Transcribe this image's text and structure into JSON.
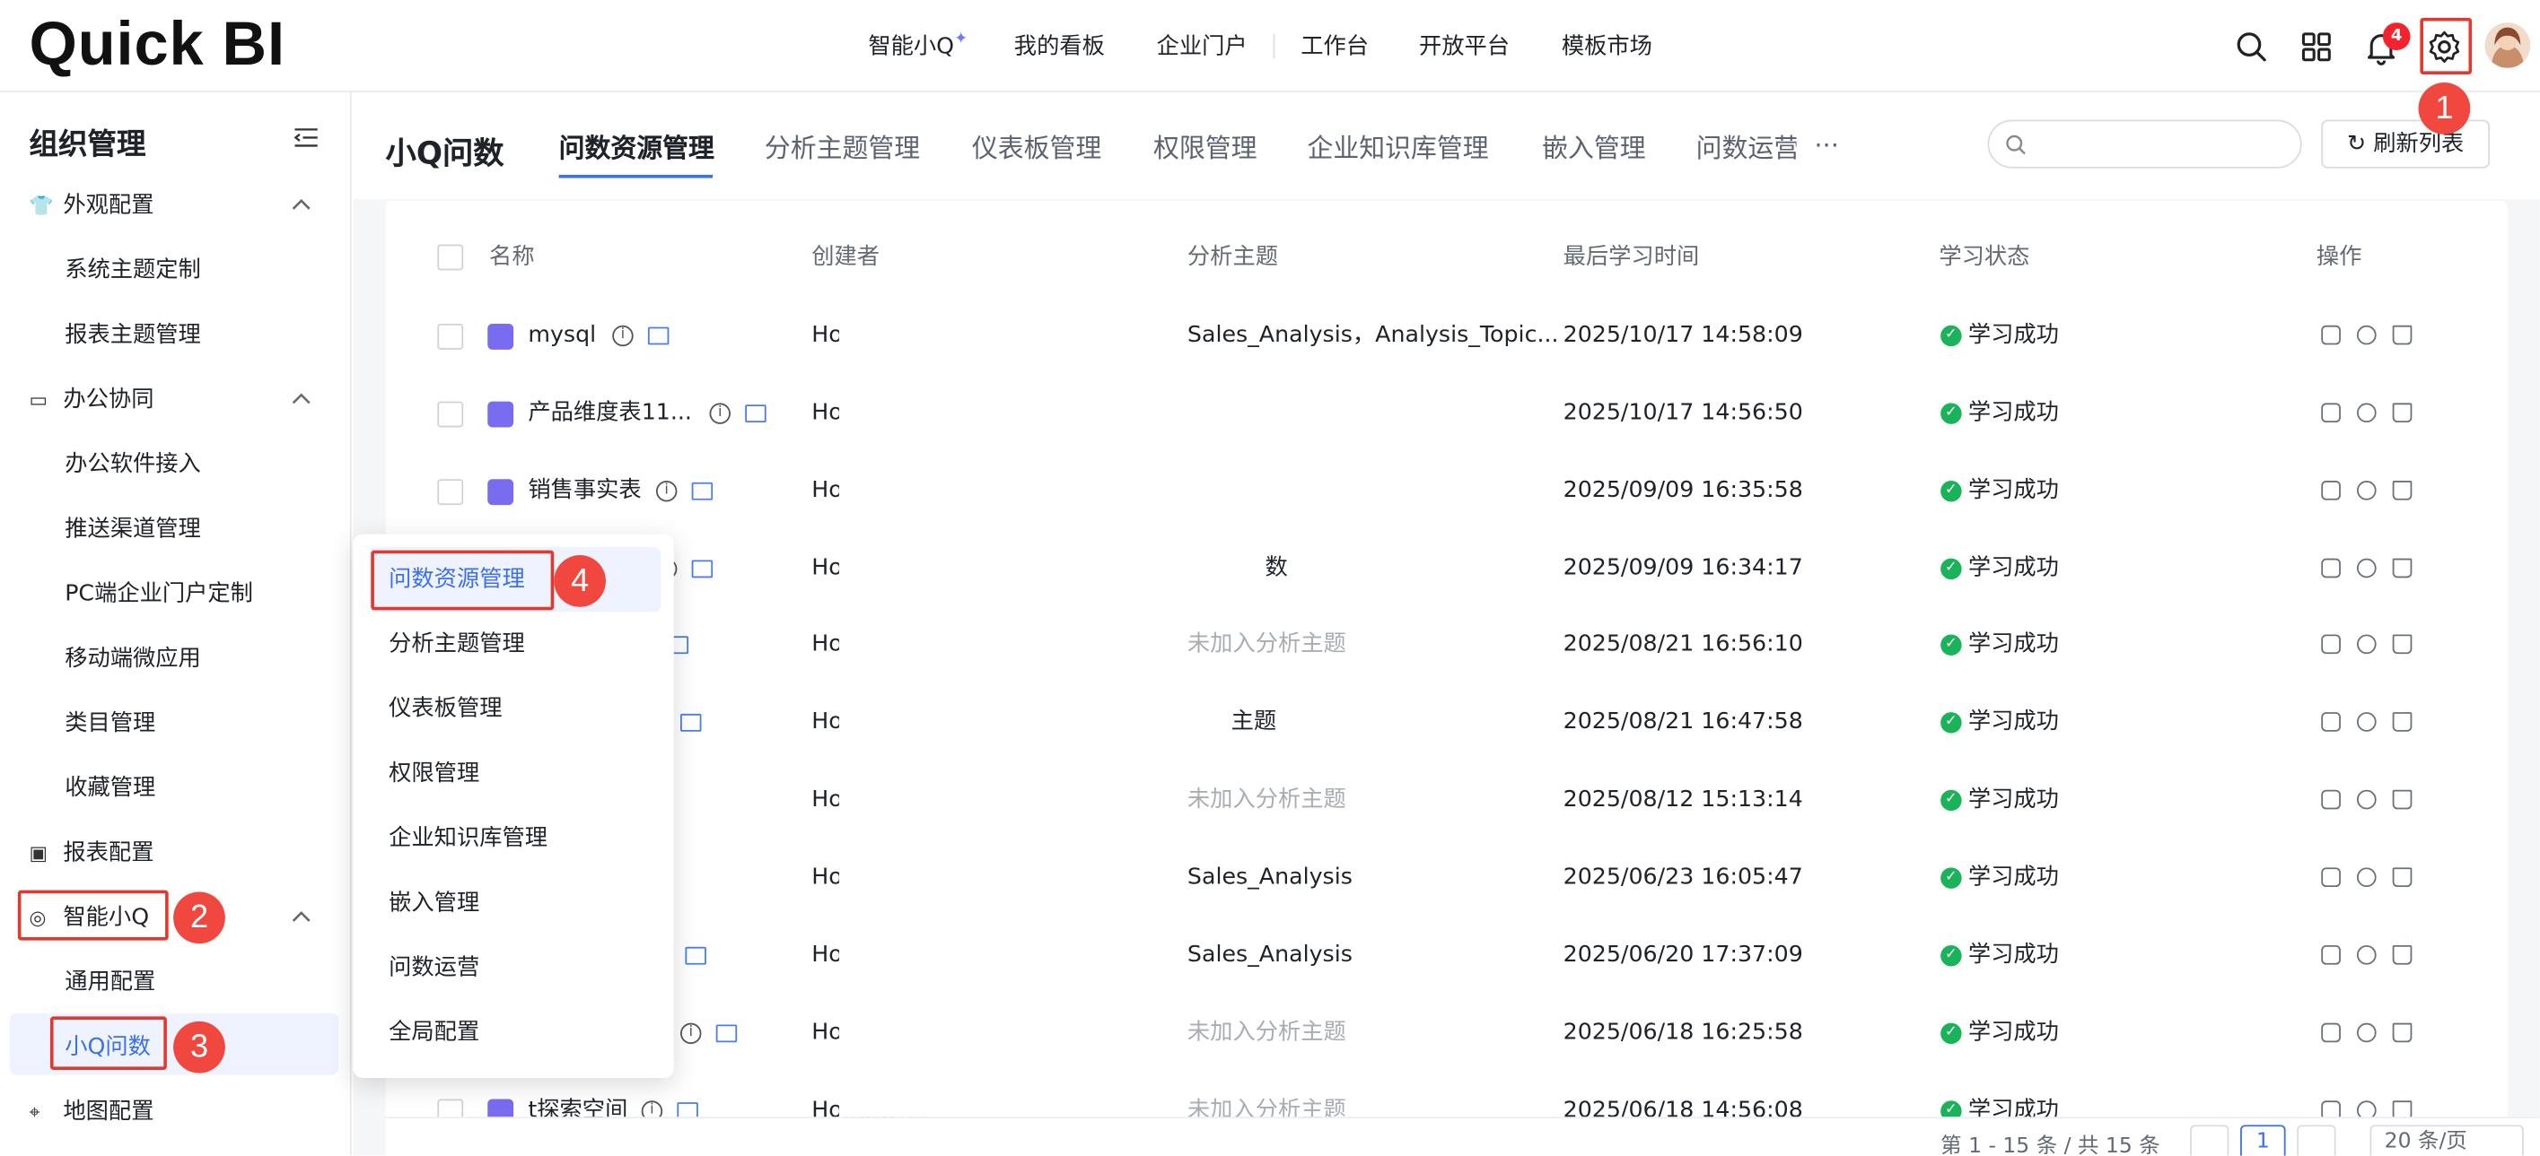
{
  "topbar": {
    "logo": "Quick BI",
    "nav": [
      "智能小Q",
      "我的看板",
      "企业门户",
      "工作台",
      "开放平台",
      "模板市场"
    ],
    "notification_count": "4",
    "icons": [
      "search-icon",
      "apps-grid-icon",
      "bell-icon",
      "gear-icon",
      "avatar"
    ]
  },
  "sidebar": {
    "title": "组织管理",
    "sections": [
      {
        "label": "外观配置",
        "icon": "shirt-icon",
        "items": [
          "系统主题定制",
          "报表主题管理"
        ]
      },
      {
        "label": "办公协同",
        "icon": "office-icon",
        "items": [
          "办公软件接入",
          "推送渠道管理",
          "PC端企业门户定制",
          "移动端微应用",
          "类目管理",
          "收藏管理"
        ]
      },
      {
        "label": "报表配置",
        "icon": "report-icon",
        "items": []
      },
      {
        "label": "智能小Q",
        "icon": "smart-q-icon",
        "items": [
          "通用配置",
          "小Q问数"
        ]
      },
      {
        "label": "地图配置",
        "icon": "map-icon",
        "items": []
      }
    ]
  },
  "content": {
    "title": "小Q问数",
    "tabs": [
      "问数资源管理",
      "分析主题管理",
      "仪表板管理",
      "权限管理",
      "企业知识库管理",
      "嵌入管理",
      "问数运营",
      "···"
    ],
    "search_placeholder": "",
    "refresh_label": "刷新列表",
    "columns": [
      "名称",
      "创建者",
      "分析主题",
      "最后学习时间",
      "学习状态",
      "操作"
    ],
    "rows": [
      {
        "name": "mysql",
        "creator": "Ho",
        "topic": "Sales_Analysis，Analysis_Topic...",
        "time": "2025/10/17 14:58:09",
        "status": "学习成功"
      },
      {
        "name": "产品维度表11...",
        "creator": "Ho",
        "topic": "",
        "time": "2025/10/17 14:56:50",
        "status": "学习成功"
      },
      {
        "name": "销售事实表",
        "creator": "Ho",
        "topic": "",
        "time": "2025/09/09 16:35:58",
        "status": "学习成功"
      },
      {
        "name": "",
        "creator": "Ho",
        "topic": "数",
        "time": "2025/09/09 16:34:17",
        "status": "学习成功"
      },
      {
        "name": "",
        "creator": "Ho",
        "topic": "未加入分析主题",
        "time": "2025/08/21 16:56:10",
        "status": "学习成功"
      },
      {
        "name": "",
        "creator": "Ho",
        "topic": "主题",
        "time": "2025/08/21 16:47:58",
        "status": "学习成功"
      },
      {
        "name": "",
        "creator": "Ho",
        "topic": "未加入分析主题",
        "time": "2025/08/12 15:13:14",
        "status": "学习成功"
      },
      {
        "name": "",
        "creator": "Ho",
        "topic": "Sales_Analysis",
        "time": "2025/06/23 16:05:47",
        "status": "学习成功"
      },
      {
        "name": "",
        "creator": "Ho",
        "topic": "Sales_Analysis",
        "time": "2025/06/20 17:37:09",
        "status": "学习成功"
      },
      {
        "name": "",
        "creator": "Ho",
        "topic": "未加入分析主题",
        "time": "2025/06/18 16:25:58",
        "status": "学习成功"
      },
      {
        "name": "t探索空间",
        "creator": "HongKong",
        "topic": "未加入分析主题",
        "time": "2025/06/18 14:56:08",
        "status": "学习成功"
      }
    ],
    "pager": {
      "summary": "第 1 - 15 条 / 共 15 条",
      "page": "1",
      "page_size": "20 条/页"
    }
  },
  "popup": {
    "items": [
      "问数资源管理",
      "分析主题管理",
      "仪表板管理",
      "权限管理",
      "企业知识库管理",
      "嵌入管理",
      "问数运营",
      "全局配置"
    ]
  },
  "callouts": [
    "1",
    "2",
    "3",
    "4"
  ],
  "colors": {
    "accent": "#3c6ff0",
    "highlight": "#e03a30",
    "success": "#1bb35a"
  }
}
